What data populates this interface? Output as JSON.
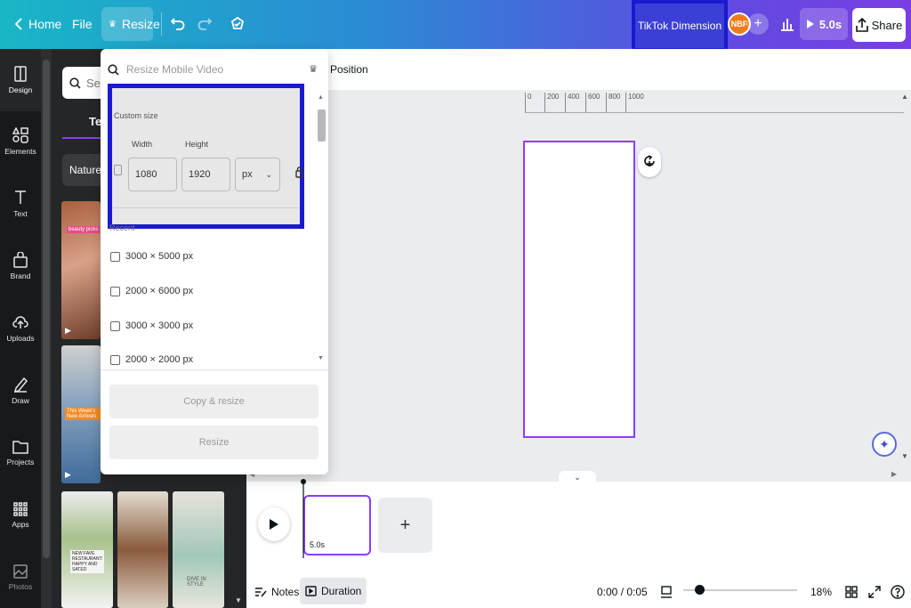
{
  "header": {
    "home_label": "Home",
    "file_label": "File",
    "resize_label": "Resize",
    "design_title": "TikTok Dimension",
    "avatar_initials": "NBF",
    "play_duration": "5.0s",
    "share_label": "Share"
  },
  "rail": {
    "items": [
      {
        "label": "Design"
      },
      {
        "label": "Elements"
      },
      {
        "label": "Text"
      },
      {
        "label": "Brand"
      },
      {
        "label": "Uploads"
      },
      {
        "label": "Draw"
      },
      {
        "label": "Projects"
      },
      {
        "label": "Apps"
      },
      {
        "label": "Photos"
      }
    ]
  },
  "panel": {
    "search_placeholder": "Sear",
    "tab_label": "Ter",
    "chip_label": "Nature",
    "thumb_texts": [
      "beauty picks",
      "This Week's New Arrivals",
      "NEW FAVE RESTAURANT: HAPPY AND SATED",
      "DIVE IN STYLE"
    ]
  },
  "resize_menu": {
    "search_placeholder": "Resize Mobile Video",
    "custom_title": "Custom size",
    "width_label": "Width",
    "height_label": "Height",
    "width_value": "1080",
    "height_value": "1920",
    "unit": "px",
    "recent_label": "Recent",
    "recent_items": [
      "3000 × 5000 px",
      "2000 × 6000 px",
      "3000 × 3000 px",
      "2000 × 2000 px"
    ],
    "copy_resize_label": "Copy & resize",
    "resize_label": "Resize"
  },
  "canvas": {
    "position_label": "Position",
    "ruler_ticks": [
      "0",
      "200",
      "400",
      "600",
      "800",
      "1000"
    ]
  },
  "timeline": {
    "clip_duration": "5.0s"
  },
  "footer": {
    "notes_label": "Notes",
    "duration_label": "Duration",
    "time": "0:00 / 0:05",
    "zoom": "18%",
    "zoom_level": 0.18
  },
  "colors": {
    "accent": "#8b3dff",
    "highlight_border": "#1a1ad0",
    "header_gradient_start": "#19b6c6",
    "header_gradient_end": "#7a3ee2"
  }
}
